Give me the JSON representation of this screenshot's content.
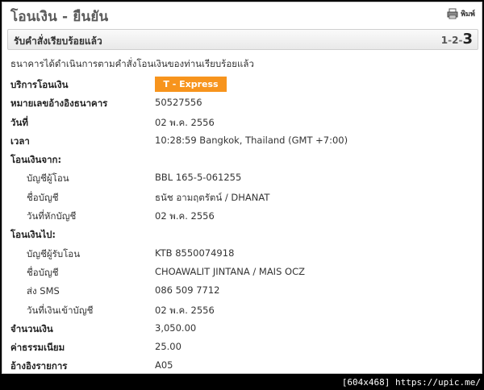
{
  "page_title": "โอนเงิน - ยืนยัน",
  "print_label": "พิมพ์",
  "status_bar": {
    "text": "รับคำสั่งเรียบร้อยแล้ว",
    "steps": [
      "1",
      "2",
      "3"
    ],
    "separator": "-",
    "active_step": "3"
  },
  "intro_text": "ธนาคารได้ดำเนินการตามคำสั่งโอนเงินของท่านเรียบร้อยแล้ว",
  "service": {
    "label": "บริการโอนเงิน",
    "badge": "T - Express",
    "badge_color": "#f7941d"
  },
  "reference": {
    "label": "หมายเลขอ้างอิงธนาคาร",
    "value": "50527556"
  },
  "date": {
    "label": "วันที่",
    "value": "02 พ.ค. 2556"
  },
  "time": {
    "label": "เวลา",
    "value": "10:28:59 Bangkok, Thailand (GMT +7:00)"
  },
  "from": {
    "heading": "โอนเงินจาก:",
    "account": {
      "label": "บัญชีผู้โอน",
      "value": "BBL 165-5-061255"
    },
    "name": {
      "label": "ชื่อบัญชี",
      "value": "ธนัช อามฤตรัตน์ / DHANAT"
    },
    "debit_date": {
      "label": "วันที่หักบัญชี",
      "value": "02 พ.ค. 2556"
    }
  },
  "to": {
    "heading": "โอนเงินไป:",
    "account": {
      "label": "บัญชีผู้รับโอน",
      "value": "KTB 8550074918"
    },
    "name": {
      "label": "ชื่อบัญชี",
      "value": "CHOAWALIT JINTANA / MAIS OCZ"
    },
    "sms": {
      "label": "ส่ง SMS",
      "value": "086 509 7712"
    },
    "credit_date": {
      "label": "วันที่เงินเข้าบัญชี",
      "value": "02 พ.ค. 2556"
    }
  },
  "amount": {
    "label": "จำนวนเงิน",
    "value": "3,050.00"
  },
  "fee": {
    "label": "ค่าธรรมเนียม",
    "value": "25.00"
  },
  "memo": {
    "label": "อ้างอิงรายการ",
    "value": "A05"
  },
  "watermark": "[604x468] https://upic.me/"
}
